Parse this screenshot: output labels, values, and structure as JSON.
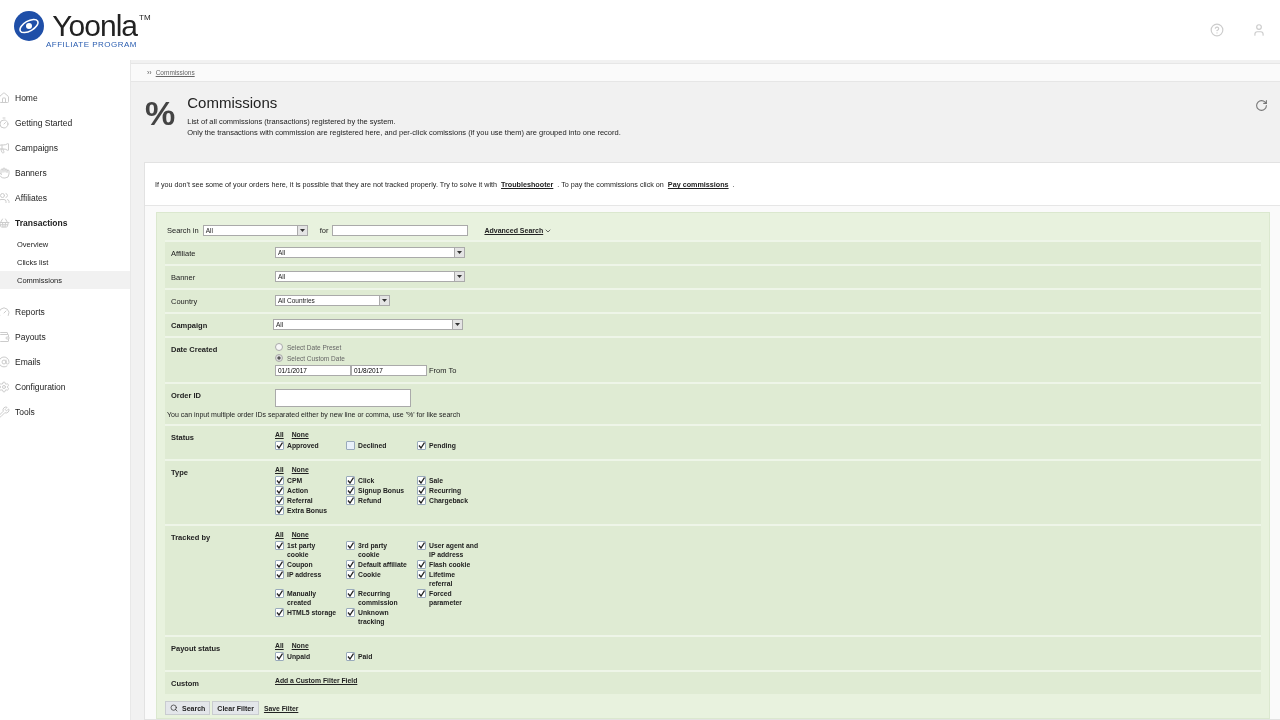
{
  "header": {
    "logo_name": "Yoonla",
    "logo_mark": "TM",
    "logo_tagline": "AFFILIATE PROGRAM"
  },
  "sidebar": {
    "items": [
      {
        "label": "Home",
        "selected": false
      },
      {
        "label": "Getting Started",
        "selected": false
      },
      {
        "label": "Campaigns",
        "selected": false
      },
      {
        "label": "Banners",
        "selected": false
      },
      {
        "label": "Affiliates",
        "selected": false
      },
      {
        "label": "Transactions",
        "selected": true,
        "expanded": true,
        "children": [
          {
            "label": "Overview",
            "selected": false
          },
          {
            "label": "Clicks list",
            "selected": false
          },
          {
            "label": "Commissions",
            "selected": true
          }
        ]
      },
      {
        "label": "Reports",
        "selected": false
      },
      {
        "label": "Payouts",
        "selected": false
      },
      {
        "label": "Emails",
        "selected": false
      },
      {
        "label": "Configuration",
        "selected": false
      },
      {
        "label": "Tools",
        "selected": false
      }
    ]
  },
  "breadcrumb": {
    "arrow": "››",
    "link": "Commissions"
  },
  "page": {
    "symbol": "%",
    "title": "Commissions",
    "description": [
      "List of all commissions (transactions) registered by the system.",
      "Only the transactions with commission are registered here, and per-click comissions (if you use them) are grouped into one record."
    ]
  },
  "notice": {
    "before": "If you don't see some of your orders here, it is possible that they are not tracked properly. Try to solve it with",
    "link1": "Troubleshooter",
    "middle": ". To pay the commissions click on",
    "link2": "Pay commissions",
    "after": "."
  },
  "search": {
    "label": "Search in",
    "value": "All",
    "for_label": "for",
    "advanced": "Advanced Search"
  },
  "filters": [
    {
      "kind": "select",
      "label": "Affiliate",
      "value": "All"
    },
    {
      "kind": "select",
      "label": "Banner",
      "value": "All"
    },
    {
      "kind": "select",
      "label": "Country",
      "value": "All Countries"
    },
    {
      "kind": "select",
      "label": "Campaign",
      "value": "All"
    },
    {
      "kind": "dates",
      "label": "Date Created",
      "options": [
        {
          "label": "Select Date Preset",
          "selected": false
        },
        {
          "label": "Select Custom Date",
          "selected": true
        }
      ],
      "from": "01/1/2017",
      "to": "01/8/2017",
      "suffix": "From To"
    },
    {
      "kind": "text",
      "label": "Order ID",
      "hint": "You can input multiple order IDs separated either by new line or comma, use '%' for like search"
    },
    {
      "kind": "checks",
      "label": "Status",
      "all": "All",
      "none": "None",
      "items": [
        {
          "label": "Approved",
          "checked": true
        },
        {
          "label": "Declined",
          "checked": false
        },
        {
          "label": "Pending",
          "checked": true
        }
      ]
    },
    {
      "kind": "checks",
      "label": "Type",
      "all": "All",
      "none": "None",
      "items": [
        {
          "label": "CPM",
          "checked": true
        },
        {
          "label": "Click",
          "checked": true
        },
        {
          "label": "Sale",
          "checked": true
        },
        {
          "label": "Action",
          "checked": true
        },
        {
          "label": "Signup Bonus",
          "checked": true
        },
        {
          "label": "Recurring",
          "checked": true
        },
        {
          "label": "Referral",
          "checked": true
        },
        {
          "label": "Refund",
          "checked": true
        },
        {
          "label": "Chargeback",
          "checked": true
        },
        {
          "label": "Extra Bonus",
          "checked": true
        }
      ]
    },
    {
      "kind": "checks",
      "label": "Tracked by",
      "all": "All",
      "none": "None",
      "items": [
        {
          "label": "1st party cookie",
          "checked": true
        },
        {
          "label": "3rd party cookie",
          "checked": true
        },
        {
          "label": "User agent and IP address",
          "checked": true
        },
        {
          "label": "Coupon",
          "checked": true
        },
        {
          "label": "Default affiliate",
          "checked": true
        },
        {
          "label": "Flash cookie",
          "checked": true
        },
        {
          "label": "IP address",
          "checked": true
        },
        {
          "label": "Cookie",
          "checked": true
        },
        {
          "label": "Lifetime referral",
          "checked": true
        },
        {
          "label": "Manually created",
          "checked": true
        },
        {
          "label": "Recurring commission",
          "checked": true
        },
        {
          "label": "Forced parameter",
          "checked": true
        },
        {
          "label": "HTML5 storage",
          "checked": true
        },
        {
          "label": "Unknown tracking",
          "checked": true
        }
      ]
    },
    {
      "kind": "checks",
      "label": "Payout status",
      "all": "All",
      "none": "None",
      "items": [
        {
          "label": "Unpaid",
          "checked": true
        },
        {
          "label": "Paid",
          "checked": true
        }
      ]
    },
    {
      "kind": "link",
      "label": "Custom",
      "link": "Add a Custom Filter Field"
    }
  ],
  "actions": {
    "search": "Search",
    "clear": "Clear Filter",
    "save": "Save Filter"
  }
}
